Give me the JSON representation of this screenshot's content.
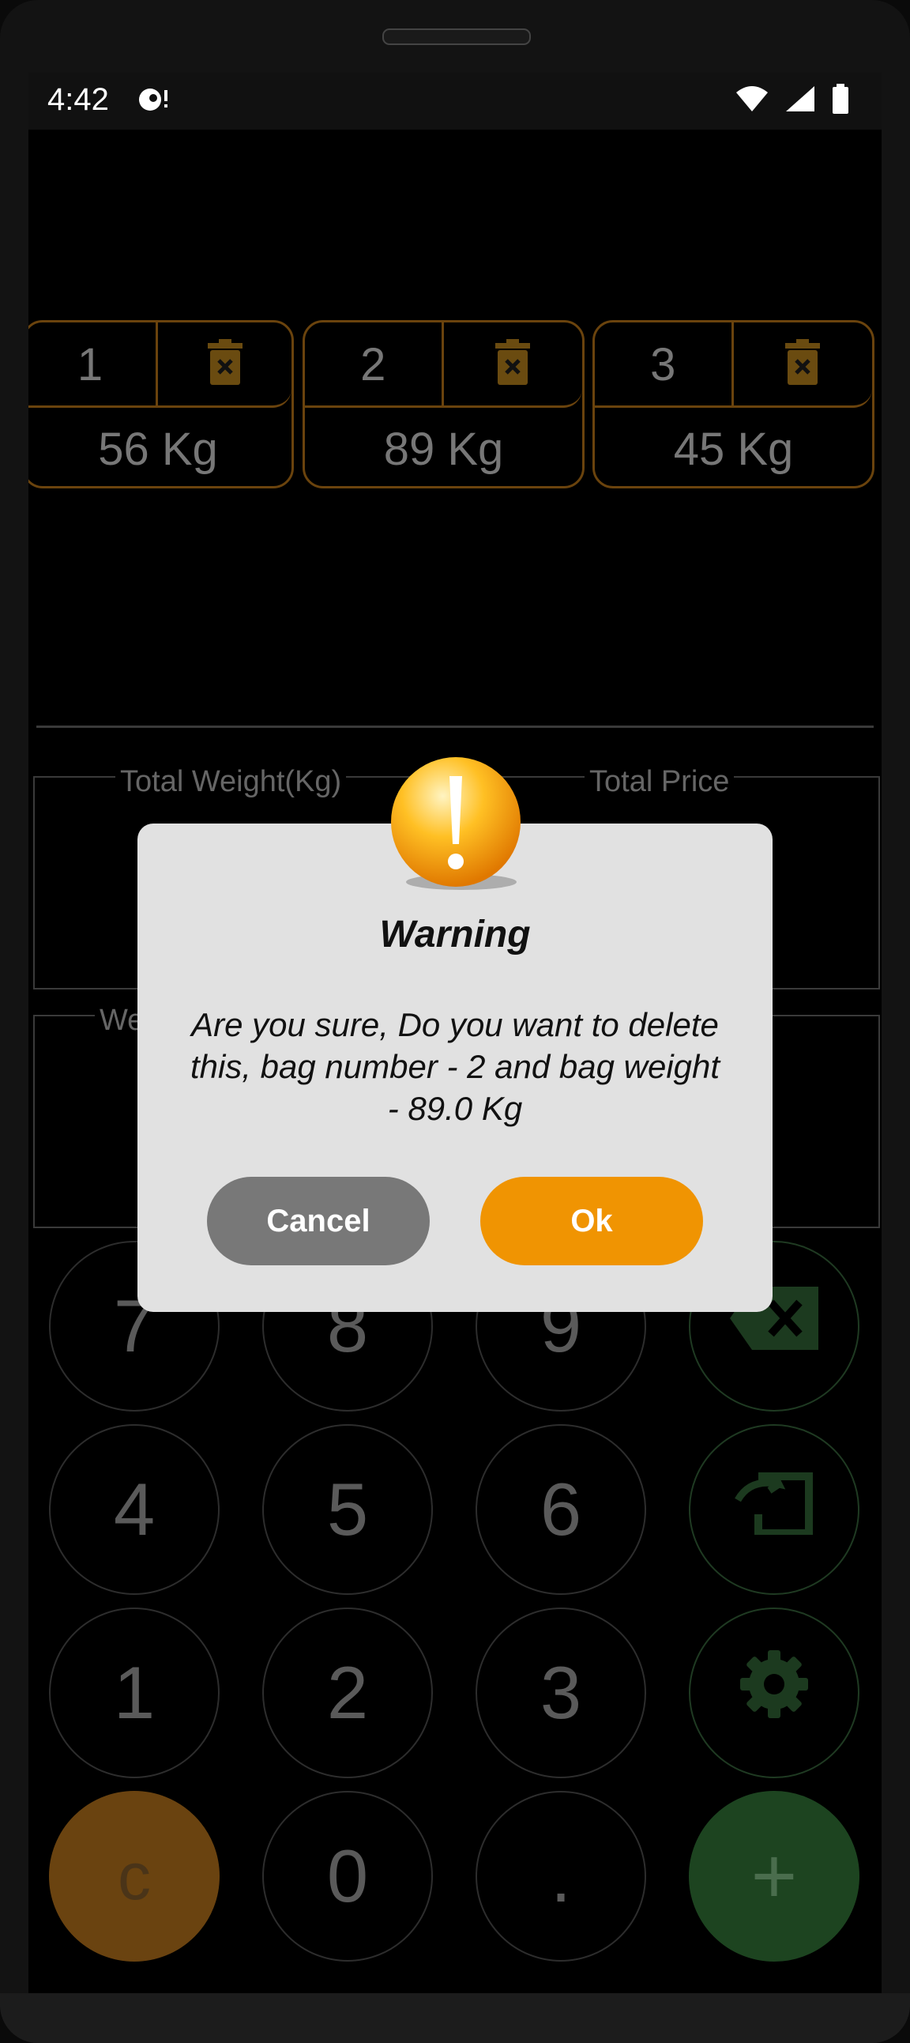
{
  "status_bar": {
    "time": "4:42"
  },
  "bags": [
    {
      "number": "1",
      "weight": "56 Kg"
    },
    {
      "number": "2",
      "weight": "89 Kg"
    },
    {
      "number": "3",
      "weight": "45 Kg"
    }
  ],
  "totals": {
    "weight_label": "Total Weight(Kg)",
    "price_label": "Total Price",
    "second_row_label": "We"
  },
  "keypad": {
    "row1": [
      "7",
      "8",
      "9"
    ],
    "row2": [
      "4",
      "5",
      "6"
    ],
    "row3": [
      "1",
      "2",
      "3"
    ],
    "row4": [
      "c",
      "0",
      ".",
      "+"
    ],
    "icons": [
      "backspace-icon",
      "export-icon",
      "settings-gear-icon"
    ]
  },
  "dialog": {
    "title": "Warning",
    "message": "Are you sure, Do you want to delete this, bag number - 2 and bag weight - 89.0 Kg",
    "cancel_label": "Cancel",
    "ok_label": "Ok"
  },
  "colors": {
    "accent_orange": "#f09402",
    "bag_border": "#6a430d",
    "clear_key": "#6a4310",
    "add_key": "#1d4420",
    "dialog_bg": "#e1e1e1",
    "cancel_button": "#787878"
  }
}
